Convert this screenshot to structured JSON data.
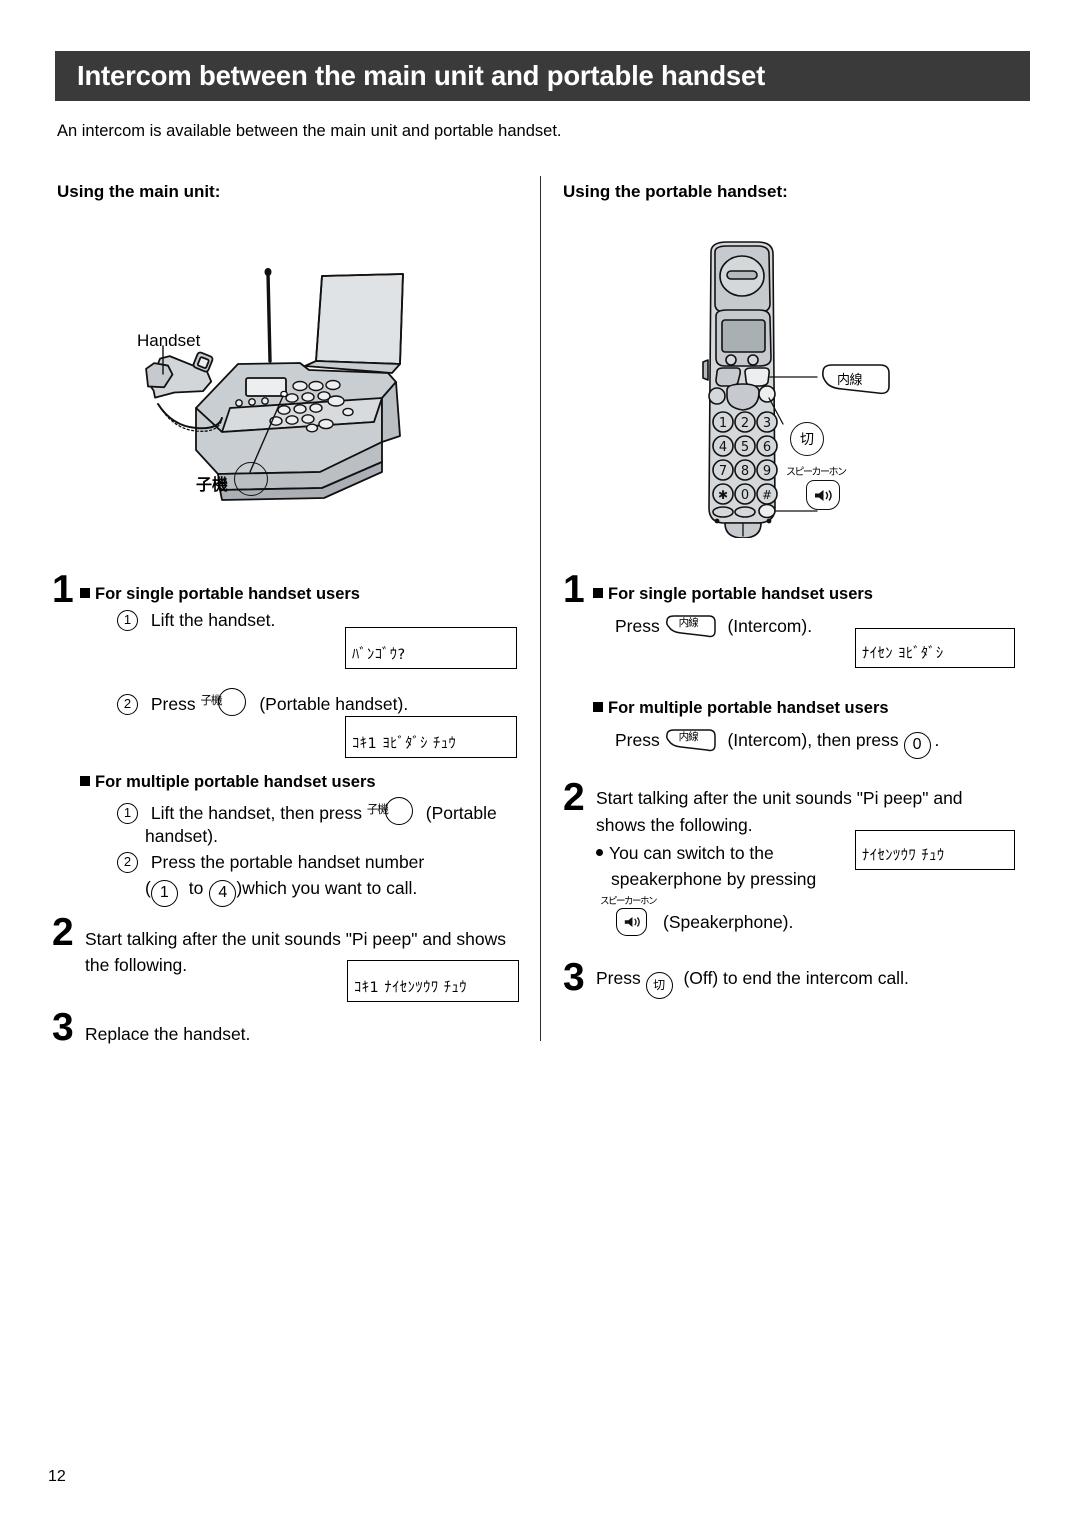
{
  "header": {
    "title": "Intercom between the main unit and portable handset"
  },
  "intro": "An intercom is available between the main unit and portable handset.",
  "columns": {
    "left": {
      "heading": "Using the main unit:",
      "figure": {
        "handset_label": "Handset",
        "portable_label": "子機"
      },
      "step1": {
        "number": "1",
        "subhead_single": "For single portable handset users",
        "item1_num": "1",
        "item1_text": "Lift the handset.",
        "lcd1": "ﾊﾞﾝｺﾞｳ?",
        "item2_num": "2",
        "item2_text_pre": "Press",
        "item2_key_label": "子機",
        "item2_text_post": "(Portable handset).",
        "lcd2": "ｺｷ1  ﾖﾋﾞﾀﾞｼ  ﾁｭｳ",
        "subhead_multiple": "For multiple portable handset users",
        "m_item1_num": "1",
        "m_item1_text_pre": "Lift the handset, then press",
        "m_item1_key_label": "子機",
        "m_item1_text_post": "(Portable",
        "m_item1_text_cont": "handset).",
        "m_item2_num": "2",
        "m_item2_text": "Press the portable handset number",
        "m_item2_line2_pre": "(",
        "m_item2_num_from": "1",
        "m_item2_mid": "to",
        "m_item2_num_to": "4",
        "m_item2_line2_post": ")which you want to call."
      },
      "step2": {
        "number": "2",
        "line1": "Start talking after the unit sounds \"Pi peep\" and shows",
        "line2": "the following.",
        "lcd": "ｺｷ1  ﾅｲｾﾝﾂｳﾜ  ﾁｭｳ"
      },
      "step3": {
        "number": "3",
        "text": "Replace the handset."
      }
    },
    "right": {
      "heading": "Using the portable handset:",
      "figure": {
        "key_naisen": "内線",
        "key_off": "切",
        "key_speaker_label": "スピーカーホン",
        "key_speaker_glyph": "◁))"
      },
      "step1": {
        "number": "1",
        "subhead_single": "For single portable handset users",
        "single_pre": "Press",
        "single_key": "内線",
        "single_post": "(Intercom).",
        "lcd1": "ﾅｲｾﾝ ﾖﾋﾞﾀﾞｼ",
        "subhead_multiple": "For multiple portable handset users",
        "multi_pre": "Press",
        "multi_key": "内線",
        "multi_mid": "(Intercom), then press",
        "multi_num": "0",
        "multi_post": "."
      },
      "step2": {
        "number": "2",
        "line1": "Start talking after the unit sounds \"Pi peep\" and",
        "line2": "shows the following.",
        "bullet_line1": "You can switch to the",
        "bullet_line2": "speakerphone by pressing",
        "spk_label": "スピーカーホン",
        "bullet_line3_post": "(Speakerphone).",
        "lcd": "ﾅｲｾﾝﾂｳﾜ ﾁｭｳ"
      },
      "step3": {
        "number": "3",
        "pre": "Press",
        "key": "切",
        "post": "(Off) to end the intercom call."
      }
    }
  },
  "footer": {
    "page_number": "12"
  }
}
